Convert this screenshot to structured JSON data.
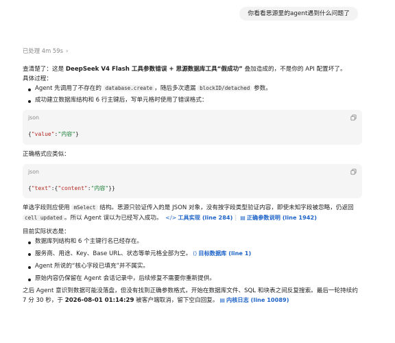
{
  "user_message": "你看看思源里的agent遇到什么问题了",
  "processed": {
    "label": "已处理 4m 59s"
  },
  "summary": {
    "before": "查清楚了：这是 ",
    "bold1": "DeepSeek V4 Flash 工具参数错误 + 思源数据库工具“假成功”",
    "after": " 叠加造成的，不是你的 API 配置坏了。"
  },
  "process": {
    "heading": "具体过程：",
    "b1_before": "Agent 先调用了不存在的 ",
    "b1_code1": "database.create",
    "b1_mid": "，随后多次遗漏 ",
    "b1_code2": "blockID/detached",
    "b1_after": " 参数。",
    "b2": "成功建立数据库结构和 6 行主键后，写单元格时使用了错误格式："
  },
  "code1": {
    "lang": "json",
    "key": "\"value\"",
    "colon": ":",
    "val": "\"内容\""
  },
  "correct_heading": "正确格式应类似：",
  "code2": {
    "lang": "json",
    "key1": "\"text\"",
    "key2": "\"content\"",
    "val": "\"内容\""
  },
  "explain": {
    "t1": "单选字段则应使用 ",
    "code1": "mSelect",
    "t2": " 结构。思源只验证传入的是 JSON 对象，没有按字段类型验证内容，即使未知字段被忽略，仍返回 ",
    "code2": "cell updated",
    "t3": "。所以 Agent 误以为已经写入成功。",
    "link1": "工具实现 (line 284)",
    "link2": "正确参数说明 (line 1942)"
  },
  "status": {
    "heading": "目前实际状态是：",
    "items": [
      "数据库列结构和 6 个主键行名已经存在。",
      "服务商、用途、Key、Base URL、状态等单元格全部为空。",
      "Agent 所说的“核心字段已填充”并不属实。",
      "原始内容仍保留在 Agent 会话记录中，后续修复不需要你重新提供。"
    ],
    "item2_link": "目标数据库 (line 1)"
  },
  "final": {
    "t1": "之后 Agent 意识到数据可能没落盘，但没有找到正确参数格式，开始在数据库文件、SQL 和块表之间反复搜索。最后一轮持续约 7 分 30 秒，于 ",
    "bold": "2026-08-01 01:14:29",
    "t2": " 被客户端取消，留下空白回复。",
    "link": "内核日志 (line 10089)"
  },
  "colors": {
    "link": "#1e63c8",
    "key": "#b3261e",
    "string": "#1a7f37",
    "bubble": "#f3f3f4",
    "code_bg": "#f5f5f6"
  },
  "icons": [
    "chevron-right-icon",
    "copy-icon",
    "code-link-icon",
    "book-icon",
    "database-icon",
    "log-icon"
  ]
}
